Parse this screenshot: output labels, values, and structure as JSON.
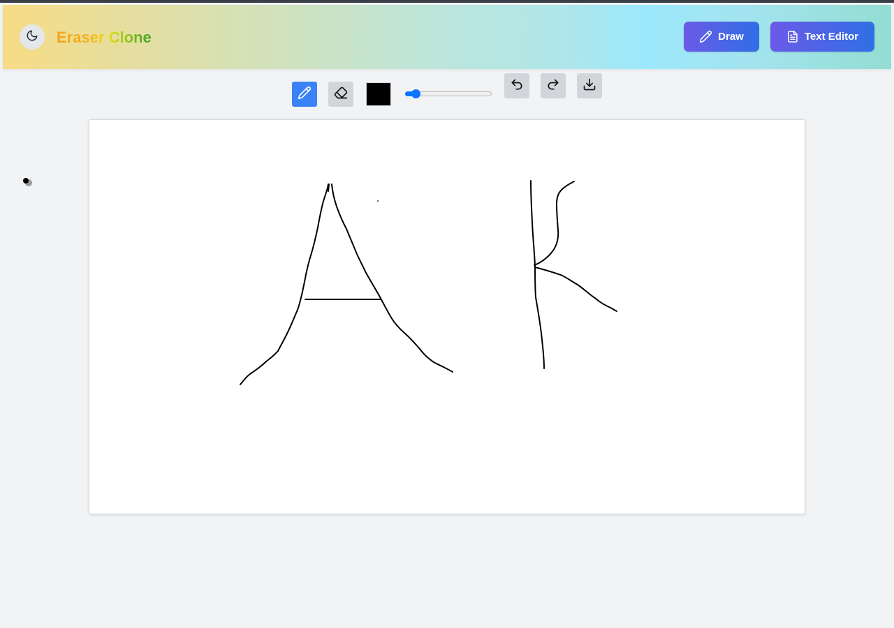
{
  "header": {
    "app_title": "Eraser Clone",
    "draw_label": "Draw",
    "text_editor_label": "Text Editor",
    "theme_icon": "moon-icon"
  },
  "toolbar": {
    "active_tool": "pencil",
    "tools": [
      "pencil-icon",
      "eraser-icon"
    ],
    "stroke_color": "#000000",
    "stroke_width_fraction": 0.08,
    "actions": [
      "undo-icon",
      "redo-icon",
      "download-icon"
    ]
  },
  "colors": {
    "accent": "#3b82f6",
    "button_gradient_start": "#6b5ae7",
    "button_gradient_end": "#2f6fe5",
    "page_background": "#f2f3f5"
  },
  "canvas": {
    "drawn_content": [
      "A",
      "K"
    ]
  }
}
